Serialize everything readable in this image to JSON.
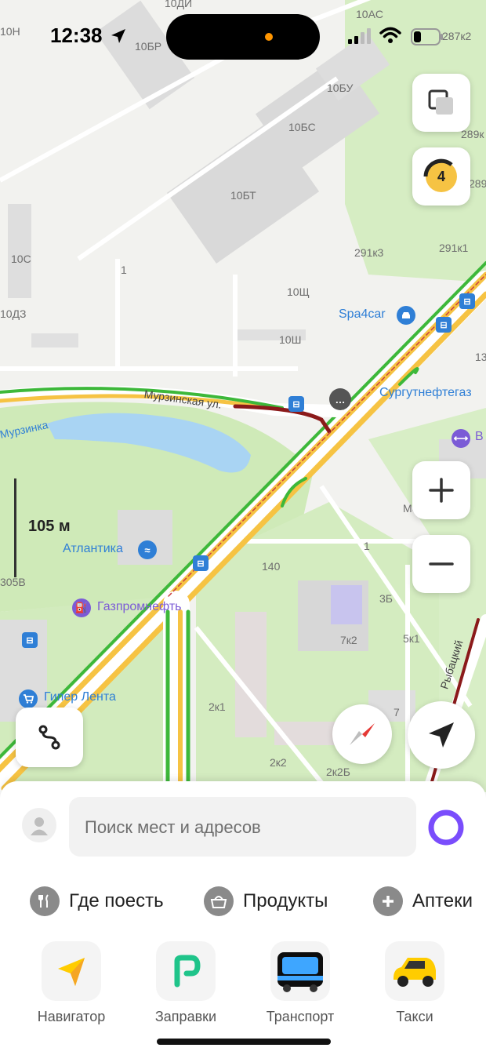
{
  "status_bar": {
    "time": "12:38"
  },
  "map": {
    "building_labels": [
      "10ДИ",
      "10AC",
      "10Н",
      "10БР",
      "10БУ",
      "10БС",
      "289к",
      "10БТ",
      "289",
      "291к3",
      "291к1",
      "10С",
      "1",
      "10Щ",
      "10ДЗ",
      "10Ш",
      "13",
      "140",
      "1",
      "3Б",
      "7к2",
      "5к1",
      "2к1",
      "7",
      "2к2",
      "2к2Б",
      "305В",
      "287к2"
    ],
    "street_names": {
      "murzinskaya": "Мурзинская ул.",
      "murzinka": "Мурзинка",
      "rybatsky": "Рыбацкий"
    },
    "pois": {
      "spa4car": "Spa4car",
      "surgutneftegaz": "Сургутнефтегаз",
      "atlantika": "Атлантика",
      "gazpromneft": "Газпромнефть",
      "giper_lenta": "Гипер Лента",
      "moi_dokumenty": "Мои Докуме",
      "right_partial": "В"
    },
    "scale": "105 м",
    "traffic_level": "4"
  },
  "sheet": {
    "search_placeholder": "Поиск мест и адресов",
    "chips": [
      {
        "label": "Где поесть",
        "icon": "fork-knife-icon"
      },
      {
        "label": "Продукты",
        "icon": "basket-icon"
      },
      {
        "label": "Аптеки",
        "icon": "plus-icon"
      }
    ],
    "apps": [
      {
        "label": "Навигатор",
        "icon": "navigator-icon"
      },
      {
        "label": "Заправки",
        "icon": "fuel-icon"
      },
      {
        "label": "Транспорт",
        "icon": "bus-icon"
      },
      {
        "label": "Такси",
        "icon": "taxi-icon"
      }
    ]
  },
  "colors": {
    "accent_purple": "#7a4dfc",
    "traffic_yellow": "#f6c343",
    "road_green": "#3db83a",
    "road_orange": "#f5a623",
    "jam_red": "#8b1a1a",
    "poi_blue": "#2f7fd6"
  }
}
